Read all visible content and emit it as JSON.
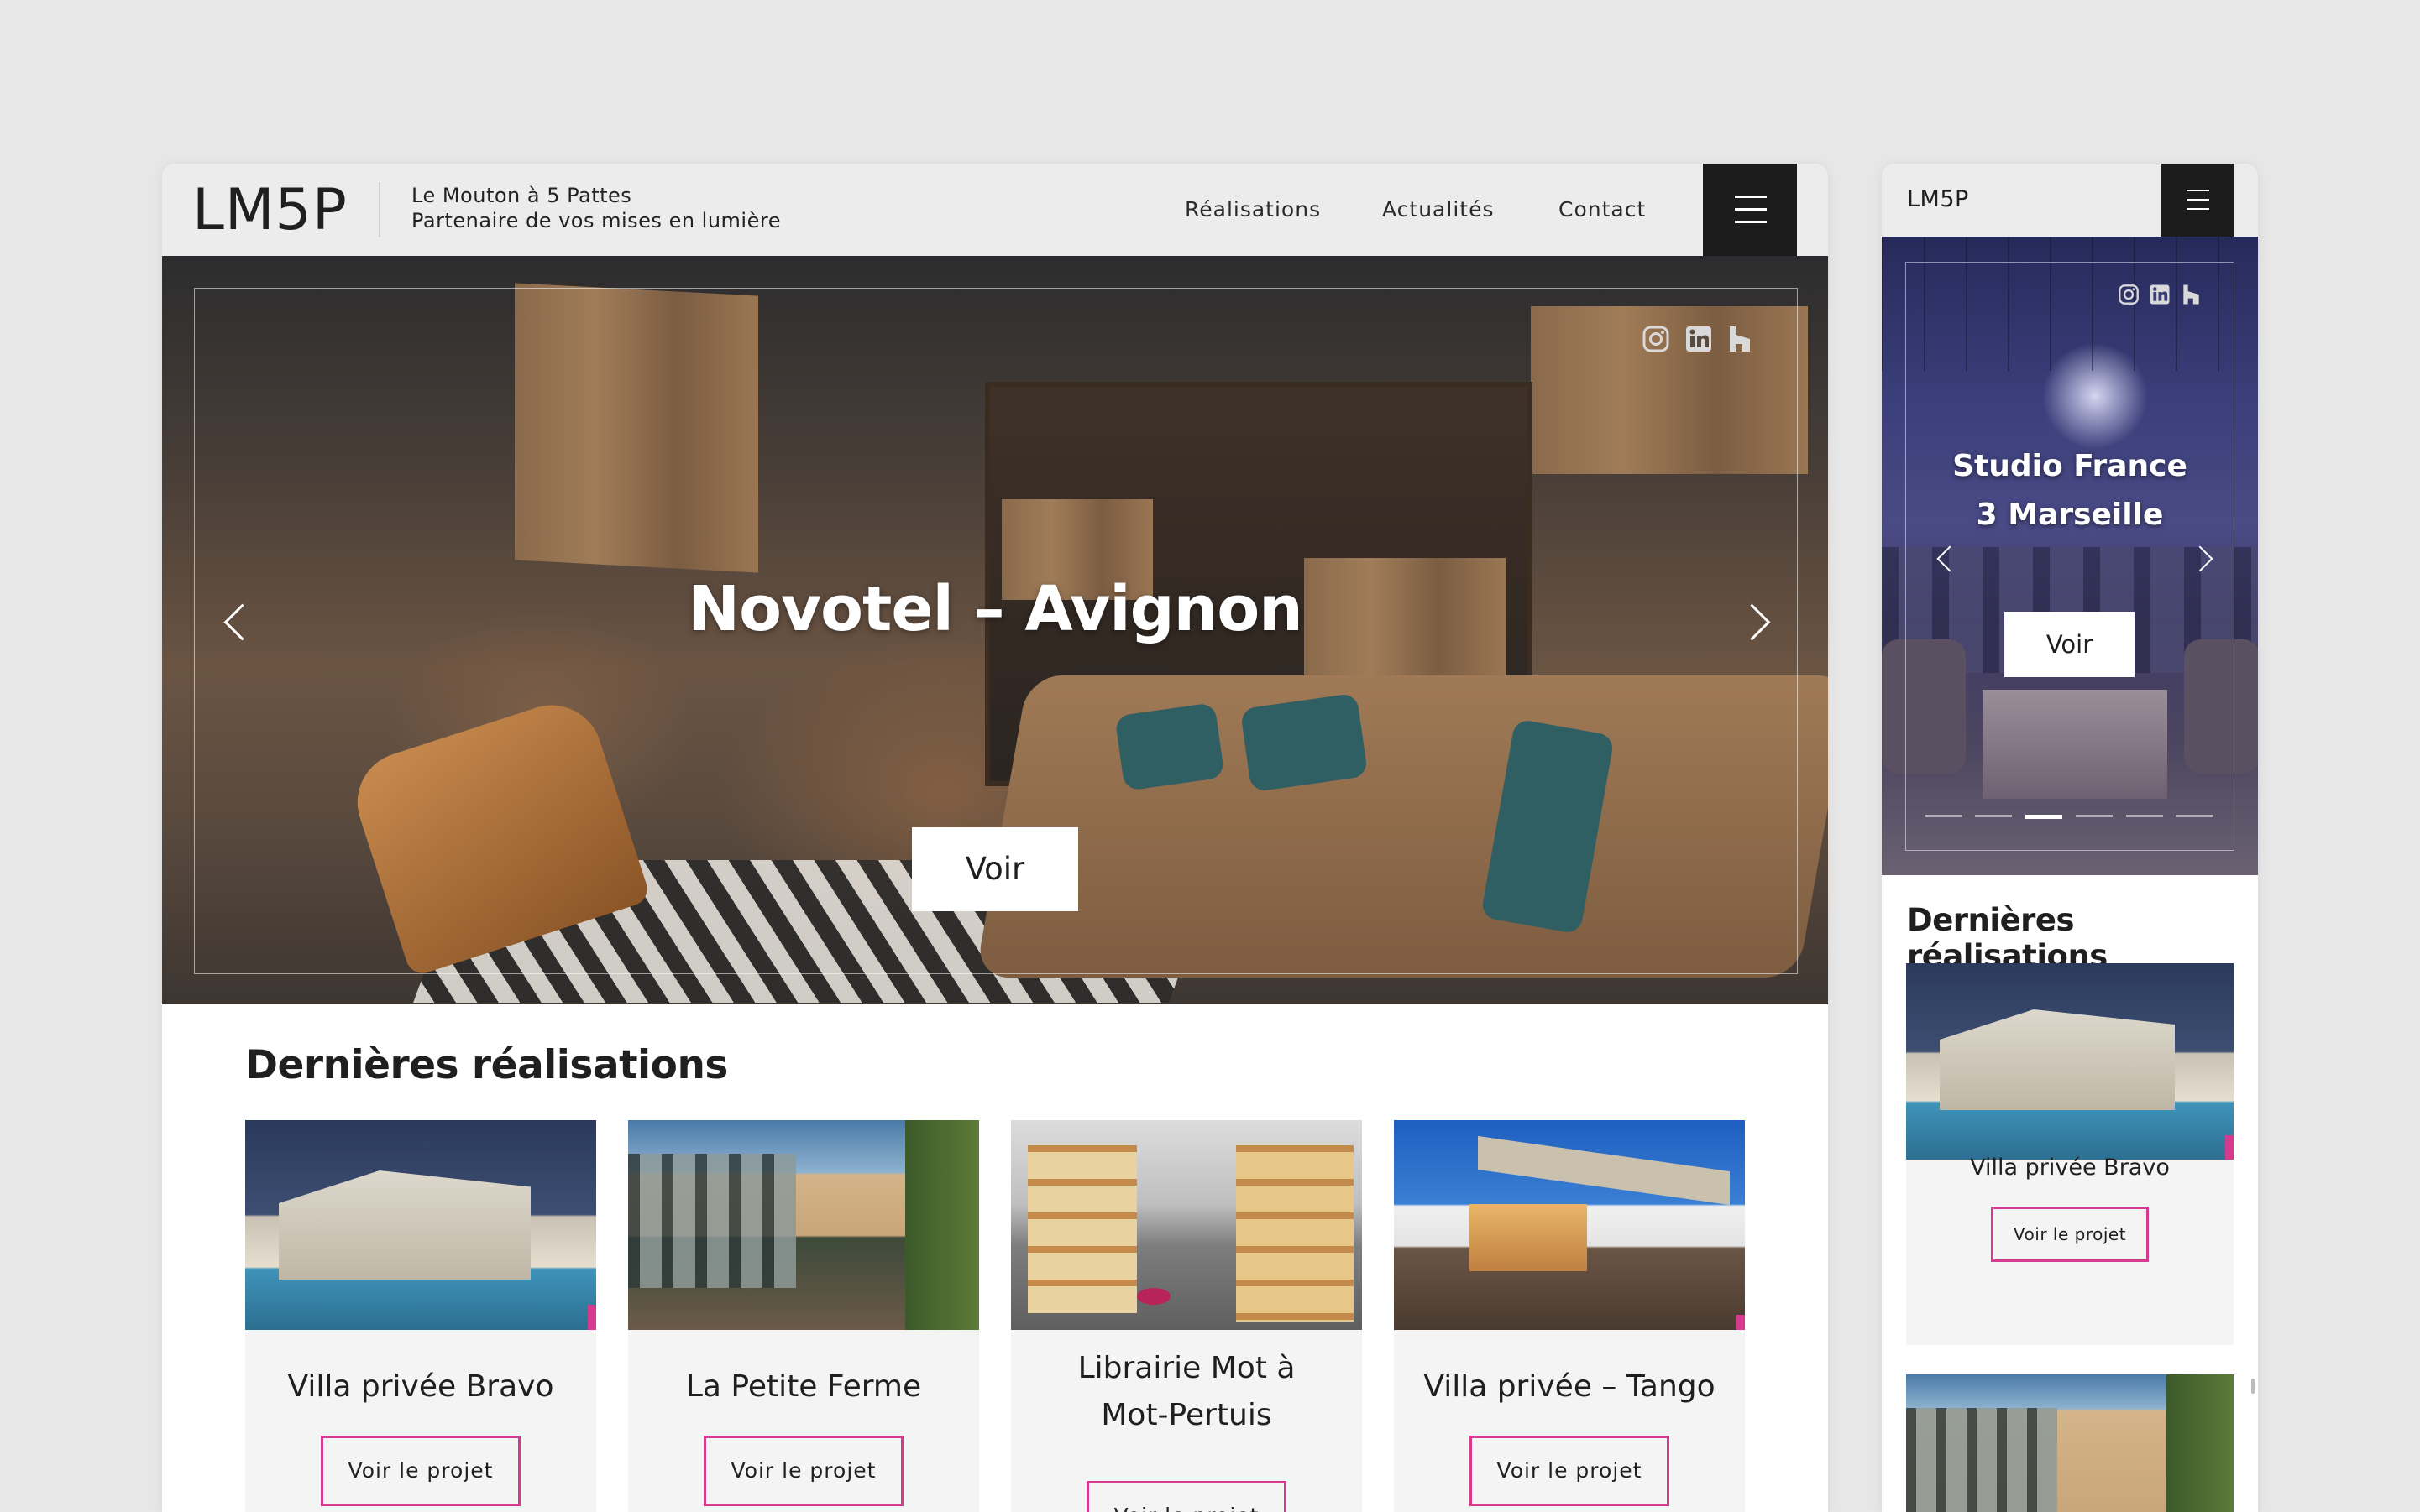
{
  "desktop": {
    "header": {
      "logo": "LM5P",
      "tagline_line1": "Le Mouton à 5 Pattes",
      "tagline_line2": "Partenaire de vos mises en lumière",
      "nav": [
        "Réalisations",
        "Actualités",
        "Contact"
      ]
    },
    "hero": {
      "title": "Novotel – Avignon",
      "button": "Voir",
      "slides_count": 6,
      "active_slide": 2
    },
    "section_title": "Dernières réalisations",
    "cards": [
      {
        "title": "Villa privée Bravo",
        "button": "Voir le projet"
      },
      {
        "title": "La Petite Ferme",
        "button": "Voir le projet"
      },
      {
        "title": "Librairie Mot à Mot-Pertuis",
        "button": "Voir le projet"
      },
      {
        "title": "Villa privée – Tango",
        "button": "Voir le projet"
      }
    ]
  },
  "mobile": {
    "header": {
      "logo": "LM5P"
    },
    "hero": {
      "title": "Studio France 3 Marseille",
      "button": "Voir",
      "slides_count": 6,
      "active_slide": 3
    },
    "section_title": "Dernières réalisations",
    "cards": [
      {
        "title": "Villa privée Bravo",
        "button": "Voir le projet"
      }
    ]
  },
  "icons": [
    "instagram-icon",
    "linkedin-icon",
    "houzz-icon",
    "chevron-left-icon",
    "chevron-right-icon",
    "hamburger-menu-icon"
  ],
  "colors": {
    "accent": "#d63a8e",
    "header_bg": "#ececec",
    "menu_bg": "#1c1c1c",
    "page_bg": "#e7e7e7"
  }
}
